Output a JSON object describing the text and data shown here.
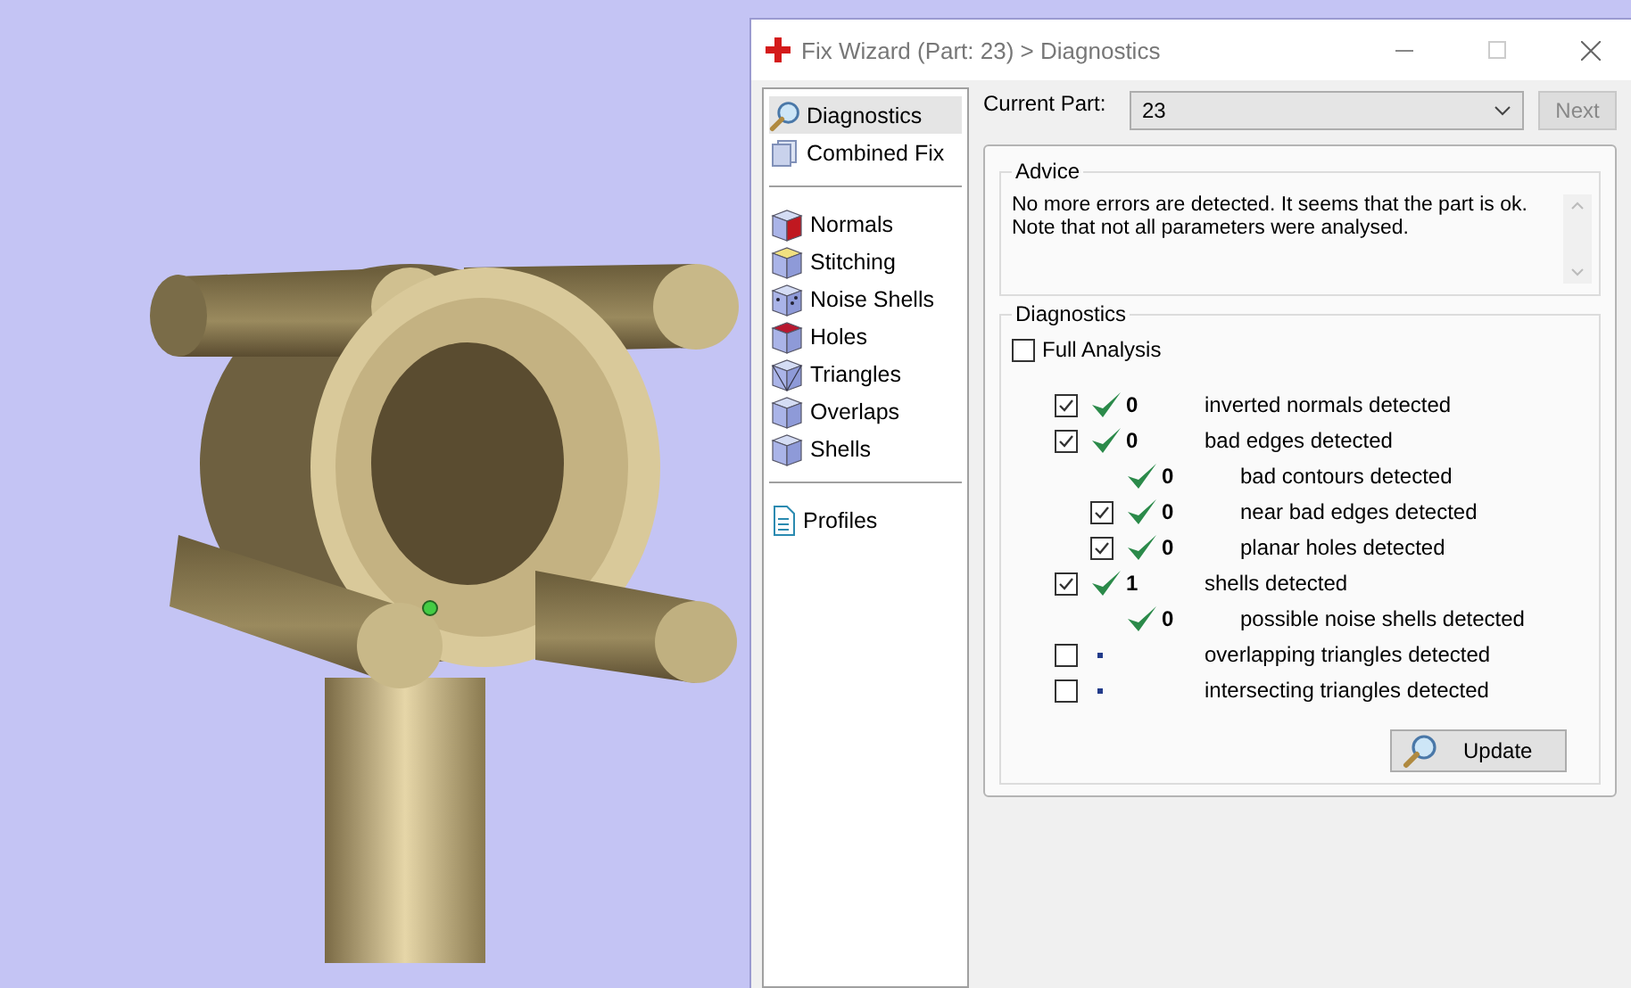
{
  "window": {
    "title": "Fix Wizard (Part: 23) > Diagnostics"
  },
  "sidebar": {
    "groups": [
      [
        {
          "label": "Diagnostics",
          "selected": true
        },
        {
          "label": "Combined Fix",
          "selected": false
        }
      ],
      [
        {
          "label": "Normals",
          "selected": false
        },
        {
          "label": "Stitching",
          "selected": false
        },
        {
          "label": "Noise Shells",
          "selected": false
        },
        {
          "label": "Holes",
          "selected": false
        },
        {
          "label": "Triangles",
          "selected": false
        },
        {
          "label": "Overlaps",
          "selected": false
        },
        {
          "label": "Shells",
          "selected": false
        }
      ],
      [
        {
          "label": "Profiles",
          "selected": false
        }
      ]
    ]
  },
  "current_part": {
    "label": "Current Part:",
    "value": "23",
    "next_button": "Next"
  },
  "advice": {
    "title": "Advice",
    "text": "No more errors are detected. It seems that the part is ok.\nNote that not all parameters were analysed."
  },
  "diagnostics": {
    "title": "Diagnostics",
    "full_analysis": {
      "label": "Full Analysis",
      "checked": false
    },
    "rows": [
      {
        "kind": "checkable",
        "checked": true,
        "passed": true,
        "count": "0",
        "label": "inverted normals detected"
      },
      {
        "kind": "checkable",
        "checked": true,
        "passed": true,
        "count": "0",
        "label": "bad edges detected",
        "children": [
          {
            "kind": "plain",
            "passed": true,
            "count": "0",
            "label": "bad contours detected"
          },
          {
            "kind": "checkable",
            "checked": true,
            "passed": true,
            "count": "0",
            "label": "near bad edges detected"
          },
          {
            "kind": "checkable",
            "checked": true,
            "passed": true,
            "count": "0",
            "label": "planar holes detected"
          }
        ]
      },
      {
        "kind": "checkable",
        "checked": true,
        "passed": true,
        "count": "1",
        "label": "shells detected",
        "children": [
          {
            "kind": "plain",
            "passed": true,
            "count": "0",
            "label": "possible noise shells detected"
          }
        ]
      },
      {
        "kind": "checkable",
        "checked": false,
        "passed": false,
        "label": "overlapping triangles detected"
      },
      {
        "kind": "checkable",
        "checked": false,
        "passed": false,
        "label": "intersecting triangles detected"
      }
    ],
    "update_button": "Update"
  }
}
